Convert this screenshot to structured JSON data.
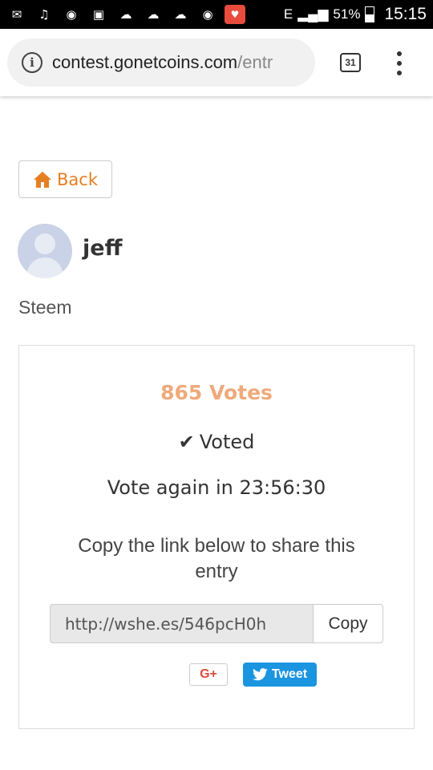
{
  "status_bar": {
    "icons": [
      "message-icon",
      "music-icon",
      "instagram-icon",
      "gallery-icon",
      "cloud-icon",
      "cloud-icon",
      "cloud-icon",
      "instagram-icon",
      "app-icon"
    ],
    "network": "E",
    "battery": "51%",
    "battery_level": 0.51,
    "time": "15:15"
  },
  "browser": {
    "url_host": "contest.gonetcoins.com",
    "url_path": "/entr",
    "tab_count": "31"
  },
  "page": {
    "back_label": "Back",
    "username": "jeff",
    "category": "Steem",
    "votes": "865 Votes",
    "voted_label": "Voted",
    "vote_again": "Vote again in 23:56:30",
    "share_text": "Copy the link below to share this entry",
    "share_link": "http://wshe.es/546pcH0h",
    "copy_label": "Copy",
    "gplus_label": "G+",
    "tweet_label": "Tweet"
  },
  "colors": {
    "accent_orange": "#e67e22",
    "votes_color": "#f0a97a",
    "twitter_blue": "#1b95e0",
    "gplus_red": "#dd4b39"
  }
}
